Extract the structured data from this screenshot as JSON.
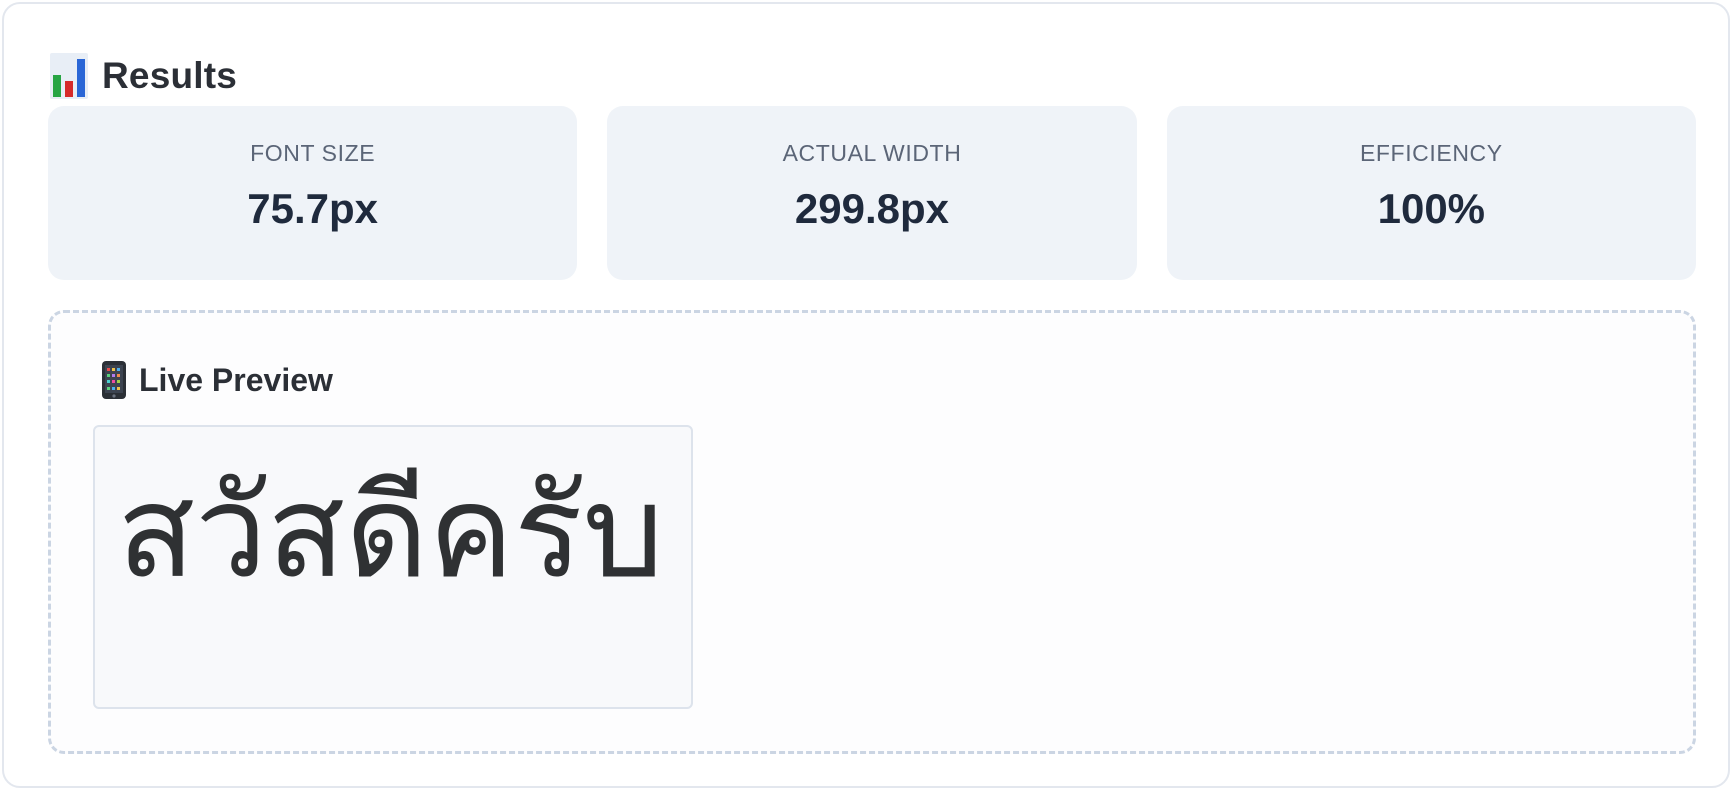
{
  "results": {
    "title": "Results",
    "icon": "bar-chart-icon",
    "metrics": [
      {
        "label": "FONT SIZE",
        "value": "75.7px"
      },
      {
        "label": "ACTUAL WIDTH",
        "value": "299.8px"
      },
      {
        "label": "EFFICIENCY",
        "value": "100%"
      }
    ]
  },
  "preview": {
    "title": "Live Preview",
    "icon": "mobile-phone-icon",
    "sample_text": "สวัสดีครับ"
  },
  "colors": {
    "card_border": "#e3e7ee",
    "metric_bg": "#eff3f8",
    "metric_label": "#5b6577",
    "metric_value": "#1f2a3d",
    "dashed_border": "#cbd5e3",
    "preview_text": "#2f3133"
  }
}
